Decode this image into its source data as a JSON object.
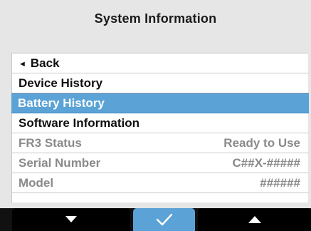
{
  "header": {
    "title": "System Information"
  },
  "menu": {
    "back_label": "Back",
    "items": [
      {
        "label": "Device History"
      },
      {
        "label": "Battery History"
      },
      {
        "label": "Software Information"
      },
      {
        "label": "FR3 Status",
        "value": "Ready to Use"
      },
      {
        "label": "Serial Number",
        "value": "C##X-#####"
      },
      {
        "label": "Model",
        "value": "######"
      }
    ],
    "selected_index": 1
  },
  "softkeys": {
    "left_icon": "triangle-down-icon",
    "middle_icon": "checkmark-icon",
    "right_icon": "triangle-up-icon"
  },
  "colors": {
    "selection": "#5ba2d6",
    "background": "#e6e6e6",
    "softkey_bar": "#000000"
  }
}
